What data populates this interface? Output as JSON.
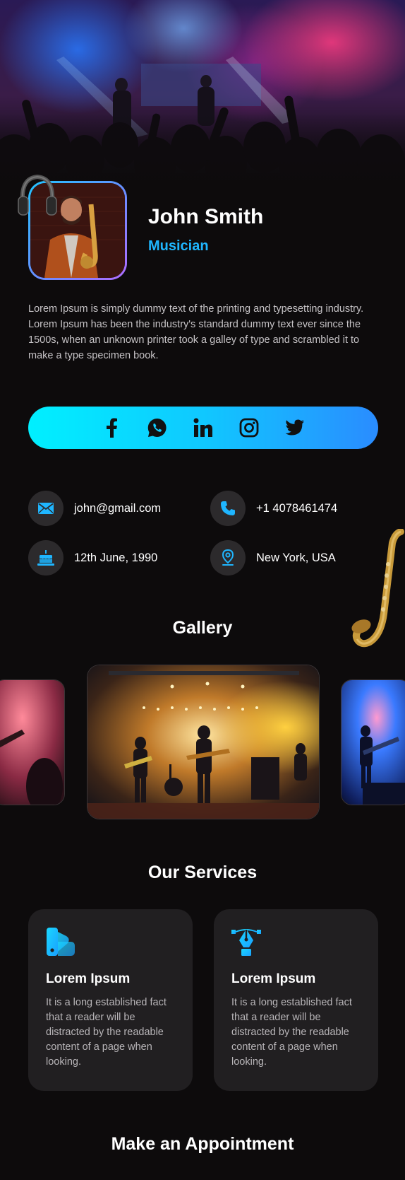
{
  "profile": {
    "name": "John Smith",
    "role": "Musician",
    "bio": "Lorem Ipsum is simply dummy text of the printing and typesetting industry. Lorem Ipsum has been the industry's standard dummy text ever since the 1500s, when an unknown printer took a galley of type and scrambled it to make a type specimen book."
  },
  "social": [
    {
      "icon": "facebook-icon"
    },
    {
      "icon": "whatsapp-icon"
    },
    {
      "icon": "linkedin-icon"
    },
    {
      "icon": "instagram-icon"
    },
    {
      "icon": "twitter-icon"
    }
  ],
  "contacts": {
    "email": "john@gmail.com",
    "phone": "+1 4078461474",
    "birthday": "12th June, 1990",
    "location": "New York, USA"
  },
  "gallery": {
    "title": "Gallery"
  },
  "services": {
    "title": "Our Services",
    "items": [
      {
        "title": "Lorem Ipsum",
        "description": "It is a long established fact that a reader will be distracted by the readable content of a page when looking.",
        "icon": "palette-icon"
      },
      {
        "title": "Lorem Ipsum",
        "description": "It is a long established fact that a reader will be distracted by the readable content of a page when looking.",
        "icon": "pen-tool-icon"
      }
    ]
  },
  "appointment": {
    "title": "Make an Appointment"
  },
  "colors": {
    "accent": "#1fb6ff",
    "background": "#0d0b0c",
    "card": "#211f21",
    "social_gradient_start": "#00f0ff",
    "social_gradient_end": "#2a8cff"
  }
}
